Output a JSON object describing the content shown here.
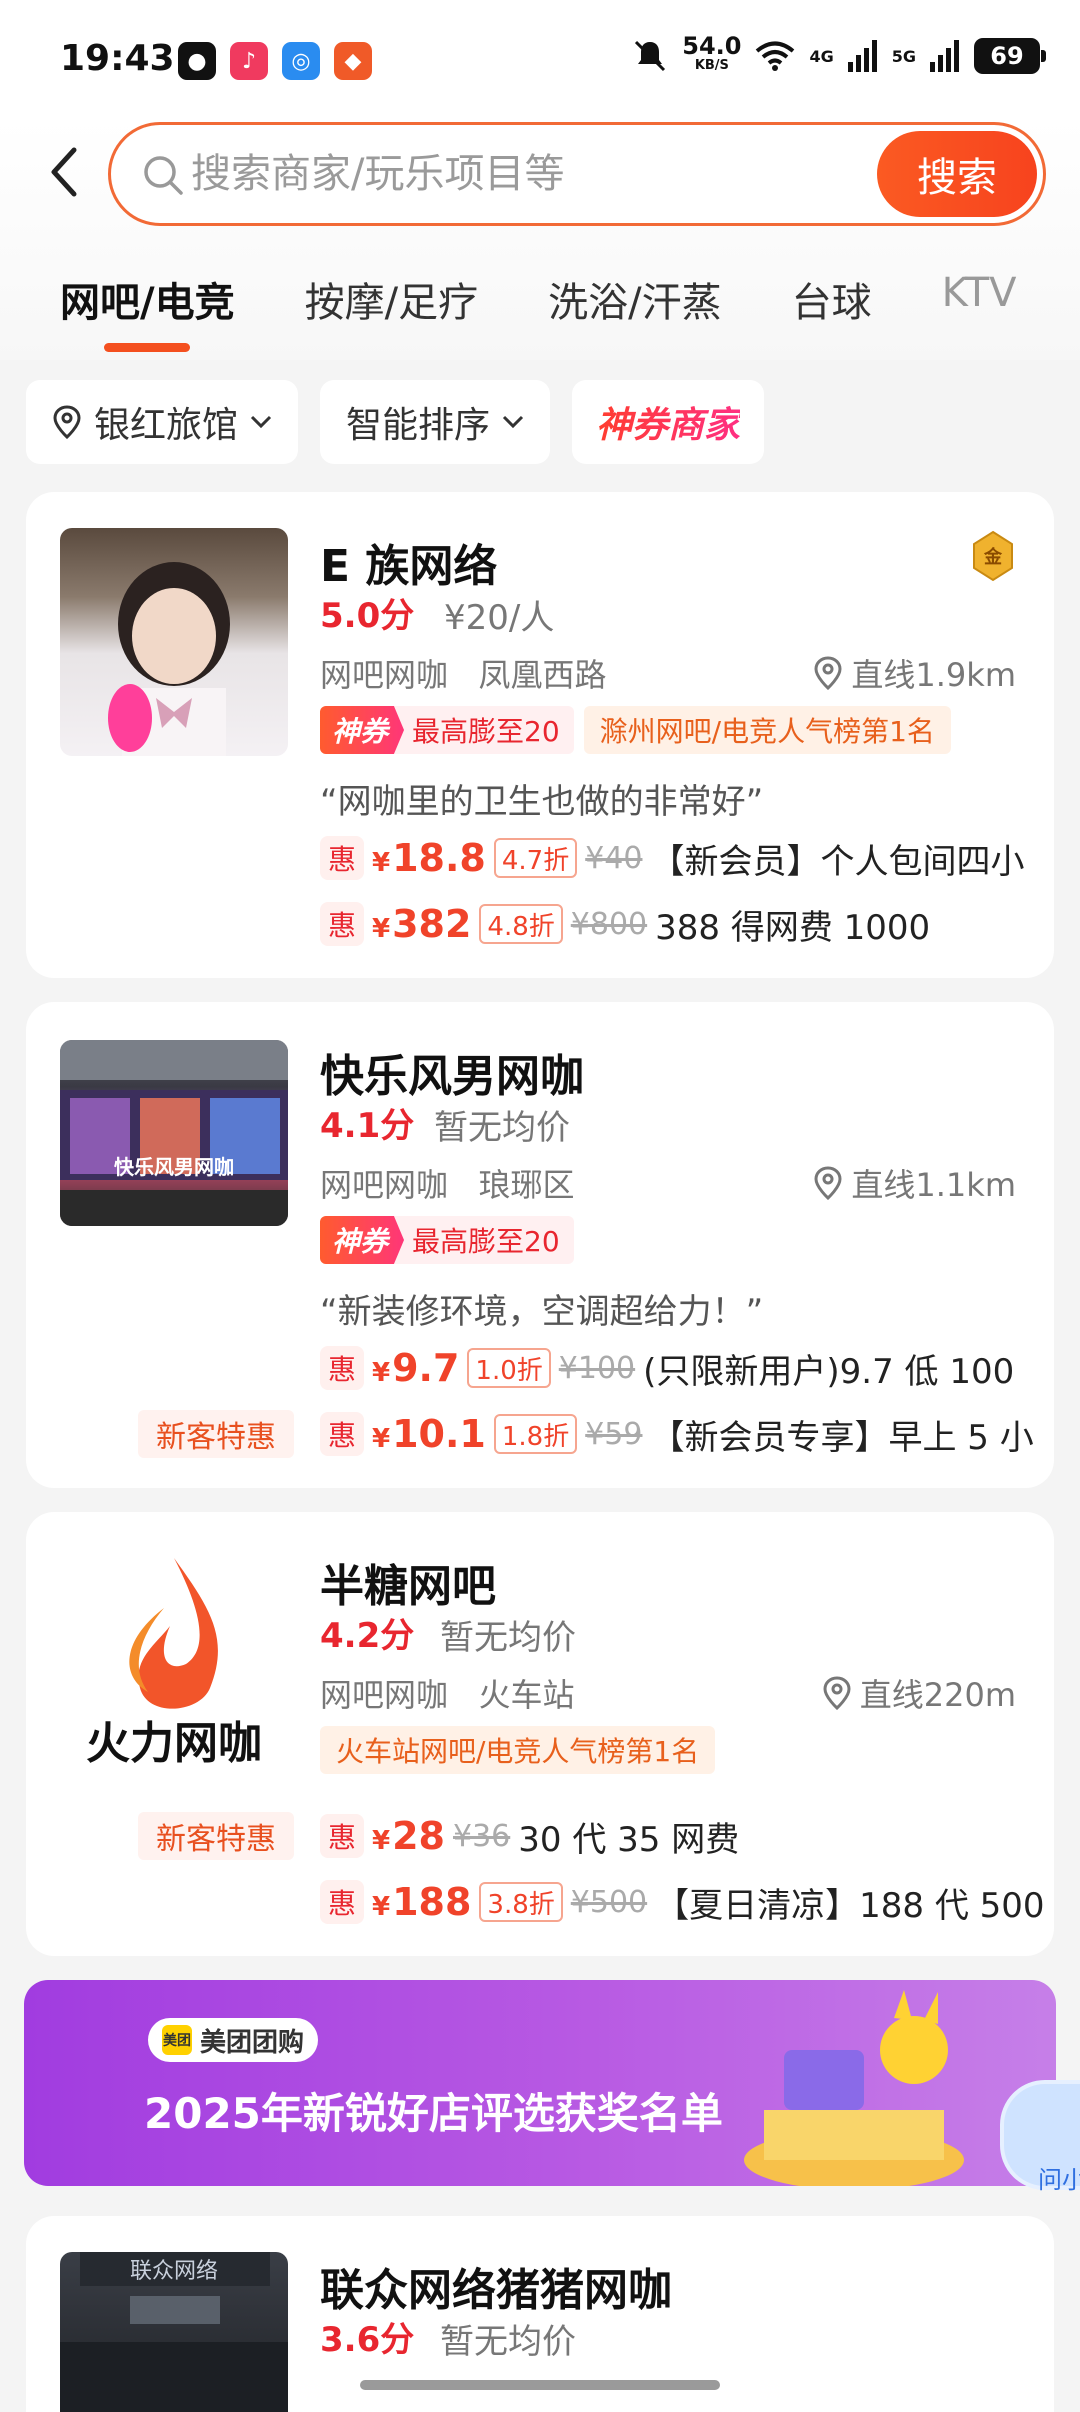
{
  "status_bar": {
    "time": "19:43",
    "net_speed": "54.0",
    "net_unit": "KB/S",
    "sig1": "4G",
    "sig2": "5G",
    "battery": "69"
  },
  "search": {
    "placeholder": "搜索商家/玩乐项目等",
    "button": "搜索"
  },
  "tabs": [
    {
      "label": "网吧/电竞",
      "active": true
    },
    {
      "label": "按摩/足疗"
    },
    {
      "label": "洗浴/汗蒸"
    },
    {
      "label": "台球"
    },
    {
      "label": "KTV"
    }
  ],
  "filters": {
    "location": "银红旅馆",
    "sort": "智能排序",
    "shenquan": "神券商家"
  },
  "shops": [
    {
      "name": "E 族网络",
      "score": "5.0分",
      "price": "¥20/人",
      "category": "网吧网咖",
      "area": "凤凰西路",
      "distance": "直线1.9km",
      "tag_sq": "神券",
      "tag_sq_text": "最高膨至20",
      "tag_rank": "滁州网吧/电竞人气榜第1名",
      "quote": "“网咖里的卫生也做的非常好”",
      "deals": [
        {
          "hui": "惠",
          "yen": "¥",
          "price": "18.8",
          "discount": "4.7折",
          "orig": "¥40",
          "desc": "【新会员】个人包间四小"
        },
        {
          "hui": "惠",
          "yen": "¥",
          "price": "382",
          "discount": "4.8折",
          "orig": "¥800",
          "desc": "388 得网费 1000"
        }
      ],
      "badge": "金"
    },
    {
      "name": "快乐风男网咖",
      "score": "4.1分",
      "price": "暂无均价",
      "category": "网吧网咖",
      "area": "琅琊区",
      "distance": "直线1.1km",
      "tag_sq": "神券",
      "tag_sq_text": "最高膨至20",
      "quote": "“新装修环境，空调超给力！”",
      "storefront_text": "快乐风男网咖",
      "newcust": "新客特惠",
      "deals": [
        {
          "hui": "惠",
          "yen": "¥",
          "price": "9.7",
          "discount": "1.0折",
          "orig": "¥100",
          "desc": "(只限新用户)9.7 低 100"
        },
        {
          "hui": "惠",
          "yen": "¥",
          "price": "10.1",
          "discount": "1.8折",
          "orig": "¥59",
          "desc": "【新会员专享】早上 5 小"
        }
      ]
    },
    {
      "name": "半糖网吧",
      "score": "4.2分",
      "price": "暂无均价",
      "category": "网吧网咖",
      "area": "火车站",
      "distance": "直线220m",
      "tag_rank": "火车站网吧/电竞人气榜第1名",
      "logo_text": "火力网咖",
      "newcust": "新客特惠",
      "deals": [
        {
          "hui": "惠",
          "yen": "¥",
          "price": "28",
          "orig": "¥36",
          "desc": "30 代 35 网费"
        },
        {
          "hui": "惠",
          "yen": "¥",
          "price": "188",
          "discount": "3.8折",
          "orig": "¥500",
          "desc": "【夏日清凉】188 代 500"
        }
      ]
    },
    {
      "name": "联众网络猪猪网咖",
      "score": "3.6分",
      "price": "暂无均价",
      "sign_text": "联众网络"
    }
  ],
  "banner": {
    "brand_logo": "美团",
    "brand": "美团团购",
    "title": "2025年新锐好店评选获奖名单"
  },
  "float_button": "问小"
}
